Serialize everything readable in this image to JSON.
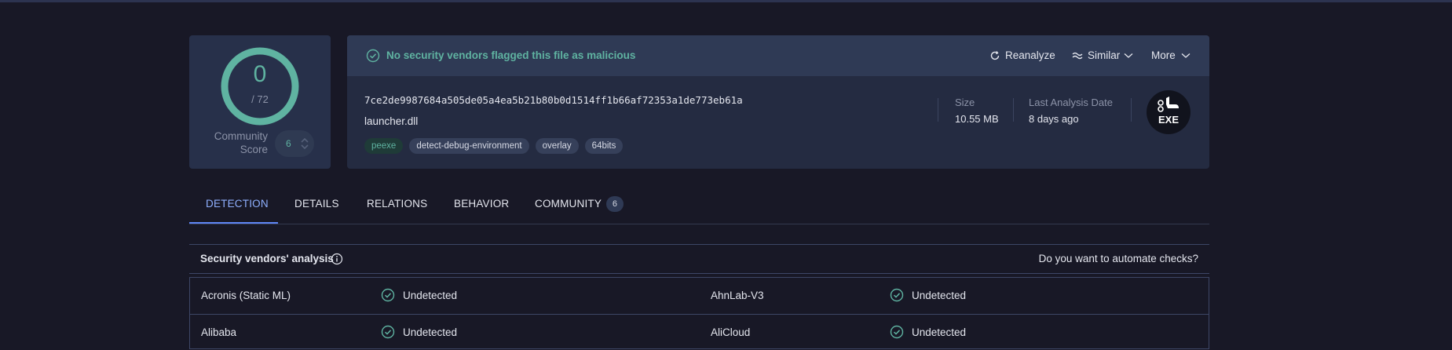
{
  "colors": {
    "accent_green": "#5fb3a1",
    "accent_blue": "#5f86f5",
    "background": "#181826"
  },
  "score": {
    "detections": "0",
    "total": "/ 72",
    "detection_fraction": 0,
    "community_label": "Community Score",
    "community_value": "6"
  },
  "header": {
    "status": "No security vendors flagged this file as malicious",
    "reanalyze": "Reanalyze",
    "similar": "Similar",
    "more": "More"
  },
  "file": {
    "hash": "7ce2de9987684a505de05a4ea5b21b80b0d1514ff1b66af72353a1de773eb61a",
    "name": "launcher.dll",
    "tags": [
      "peexe",
      "detect-debug-environment",
      "overlay",
      "64bits"
    ],
    "size_label": "Size",
    "size_value": "10.55 MB",
    "date_label": "Last Analysis Date",
    "date_value": "8 days ago",
    "type_badge": "EXE"
  },
  "tabs": [
    {
      "label": "DETECTION"
    },
    {
      "label": "DETAILS"
    },
    {
      "label": "RELATIONS"
    },
    {
      "label": "BEHAVIOR"
    },
    {
      "label": "COMMUNITY",
      "count": "6"
    }
  ],
  "analysis": {
    "title": "Security vendors' analysis",
    "automate_link": "Do you want to automate checks?",
    "rows": [
      {
        "left_vendor": "Acronis (Static ML)",
        "left_result": "Undetected",
        "right_vendor": "AhnLab-V3",
        "right_result": "Undetected"
      },
      {
        "left_vendor": "Alibaba",
        "left_result": "Undetected",
        "right_vendor": "AliCloud",
        "right_result": "Undetected"
      }
    ]
  }
}
